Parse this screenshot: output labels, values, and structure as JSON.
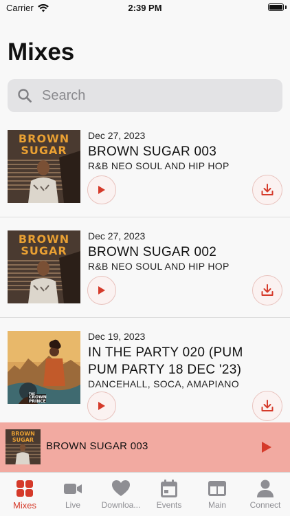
{
  "status_bar": {
    "carrier": "Carrier",
    "time": "2:39 PM"
  },
  "page": {
    "title": "Mixes"
  },
  "search": {
    "placeholder": "Search"
  },
  "colors": {
    "accent": "#d53a2a",
    "mini_player_bg": "#f2aaa1",
    "button_bg": "#fbf2f1"
  },
  "mixes": [
    {
      "date": "Dec 27, 2023",
      "title": "BROWN SUGAR 003",
      "genre": "R&B NEO SOUL AND HIP HOP",
      "artwork_text": [
        "BROWN",
        "SUGAR"
      ],
      "play_icon": "play-icon",
      "download_icon": "download-icon"
    },
    {
      "date": "Dec 27, 2023",
      "title": "BROWN SUGAR 002",
      "genre": "R&B NEO SOUL AND HIP HOP",
      "artwork_text": [
        "BROWN",
        "SUGAR"
      ],
      "play_icon": "play-icon",
      "download_icon": "download-icon"
    },
    {
      "date": "Dec 19, 2023",
      "title": "IN THE PARTY 020 (PUM PUM PARTY 18 DEC '23)",
      "genre": "DANCEHALL, SOCA, AMAPIANO",
      "artwork_text": [
        "THE",
        "CROWN",
        "PRINCE"
      ],
      "play_icon": "play-icon",
      "download_icon": "download-icon"
    }
  ],
  "mini_player": {
    "title": "BROWN SUGAR 003",
    "artwork_text": [
      "BROWN",
      "SUGAR"
    ]
  },
  "tabs": [
    {
      "label": "Mixes",
      "icon": "grid-icon",
      "active": true
    },
    {
      "label": "Live",
      "icon": "video-camera-icon",
      "active": false
    },
    {
      "label": "Downloa...",
      "icon": "heart-icon",
      "active": false
    },
    {
      "label": "Events",
      "icon": "calendar-icon",
      "active": false
    },
    {
      "label": "Main",
      "icon": "window-icon",
      "active": false
    },
    {
      "label": "Connect",
      "icon": "person-icon",
      "active": false
    }
  ]
}
